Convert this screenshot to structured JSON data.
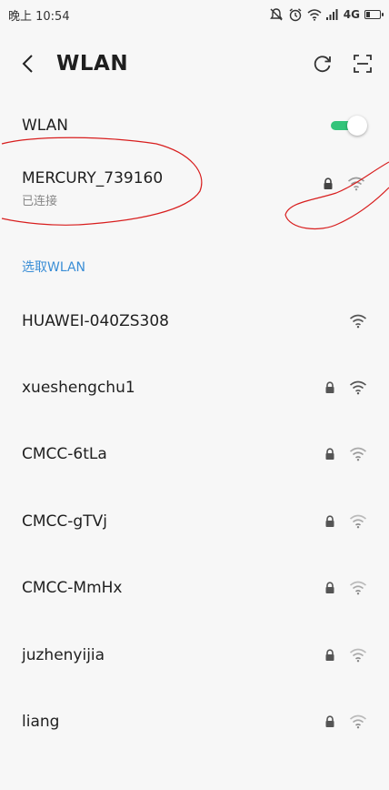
{
  "status_bar": {
    "time": "晚上 10:54",
    "network_type": "4G",
    "icons": [
      "mute-icon",
      "alarm-icon",
      "wifi-icon",
      "signal-icon",
      "battery-icon"
    ]
  },
  "toolbar": {
    "title": "WLAN",
    "back_icon": "chevron-left-icon",
    "refresh_icon": "refresh-icon",
    "scan_icon": "scan-icon"
  },
  "wlan_toggle": {
    "label": "WLAN",
    "enabled": true,
    "color": "#33c47a"
  },
  "connected_network": {
    "name": "MERCURY_739160",
    "status": "已连接",
    "secured": true
  },
  "section": {
    "label": "选取WLAN",
    "color": "#3a8ed6"
  },
  "networks": [
    {
      "name": "HUAWEI-040ZS308",
      "secured": false
    },
    {
      "name": "xueshengchu1",
      "secured": true
    },
    {
      "name": "CMCC-6tLa",
      "secured": true
    },
    {
      "name": "CMCC-gTVj",
      "secured": true
    },
    {
      "name": "CMCC-MmHx",
      "secured": true
    },
    {
      "name": "juzhenyijia",
      "secured": true
    },
    {
      "name": "liang",
      "secured": true
    }
  ]
}
